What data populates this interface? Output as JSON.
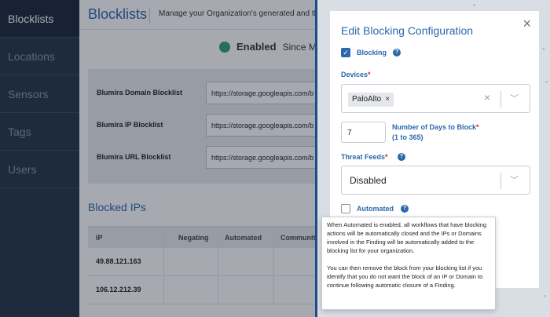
{
  "sidebar": {
    "items": [
      {
        "label": "Blocklists"
      },
      {
        "label": "Locations"
      },
      {
        "label": "Sensors"
      },
      {
        "label": "Tags"
      },
      {
        "label": "Users"
      }
    ]
  },
  "header": {
    "title": "Blocklists",
    "subtitle": "Manage your Organization's generated and threa"
  },
  "status": {
    "label": "Enabled",
    "since": "Since Ma"
  },
  "blocklists": [
    {
      "label": "Blumira Domain Blocklist",
      "url": "https://storage.googleapis.com/b"
    },
    {
      "label": "Blumira IP Blocklist",
      "url": "https://storage.googleapis.com/b"
    },
    {
      "label": "Blumira URL Blocklist",
      "url": "https://storage.googleapis.com/b"
    }
  ],
  "blocked_ips": {
    "title": "Blocked IPs",
    "columns": [
      "IP",
      "Negating",
      "Automated",
      "Communit"
    ],
    "rows": [
      {
        "ip": "49.88.121.163"
      },
      {
        "ip": "106.12.212.39"
      }
    ]
  },
  "panel": {
    "title": "Edit Blocking Configuration",
    "close": "×",
    "blocking_label": "Blocking",
    "devices_label": "Devices",
    "devices_tag": "PaloAlto",
    "days_value": "7",
    "days_label": "Number of Days to Block",
    "days_hint": "(1 to 365)",
    "feeds_label": "Threat Feeds",
    "feeds_value": "Disabled",
    "automated_label": "Automated"
  },
  "tooltip": {
    "p1": "When Automated is enabled, all workflows that have blocking actions will be automatically closed and the IPs or Domains involved in the Finding will be automatically added to the blocking list for your organization.",
    "p2": "You can then remove the block from your blocking list if you identify that you do not want the block of an IP or Domain to continue following automatic closure of a Finding."
  },
  "colors": {
    "sidebar": "#253347",
    "accent": "#2b67ad",
    "enabled": "#2fa075"
  }
}
